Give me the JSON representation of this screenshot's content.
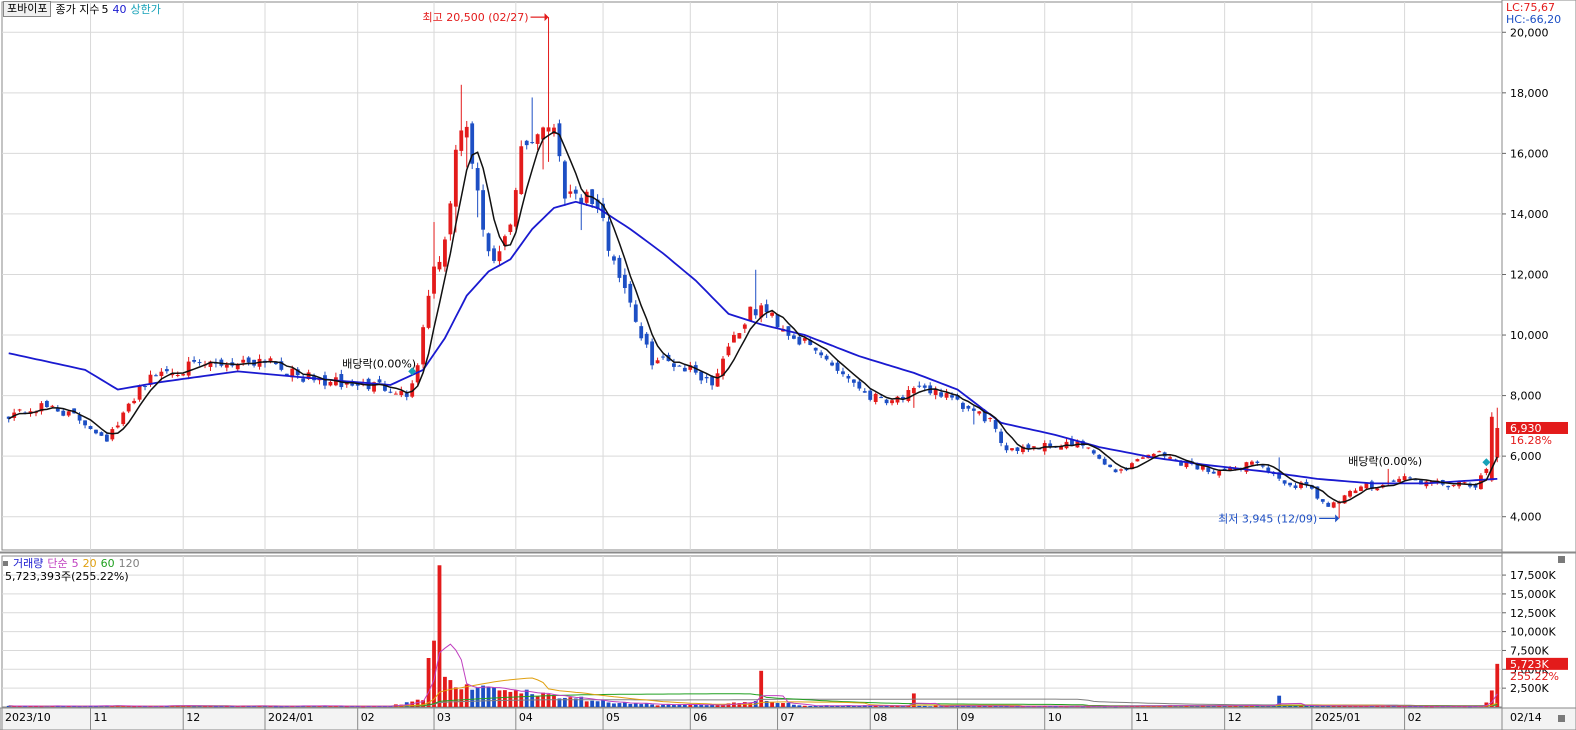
{
  "header": {
    "stock_name": "포바이포",
    "indicator_label": "종가 지수",
    "ma_short": "5",
    "ma_long": "40",
    "upper_limit_label": "상한가",
    "lc": "LC:75,67",
    "hc": "HC:-66,20"
  },
  "volume_header": {
    "title": "거래량",
    "ma_label": "단순",
    "periods": [
      "5",
      "20",
      "60",
      "120"
    ],
    "current": "5,723,393주(255.22%)"
  },
  "annotations": {
    "high": "최고 20,500 (02/27)",
    "low": "최저 3,945 (12/09)",
    "dividend_1": "배당락(0.00%)",
    "dividend_2": "배당락(0.00%)"
  },
  "price_badge": {
    "value": "6,930",
    "change": "16.28%"
  },
  "volume_badge": {
    "value": "5,723K",
    "change": "255.22%"
  },
  "colors": {
    "up": "#e31b1b",
    "down": "#1d4fc4",
    "ma5": "#111111",
    "ma40": "#1a1ad0",
    "grid": "#d9d9d9",
    "vol_ma5": "#c040c0",
    "vol_ma20": "#e0a010",
    "vol_ma60": "#20a020",
    "vol_ma120": "#808080"
  },
  "chart_data": [
    {
      "type": "candlestick",
      "title": "",
      "ylim": [
        2900,
        21000
      ],
      "y_ticks": [
        4000,
        6000,
        8000,
        10000,
        12000,
        14000,
        16000,
        18000,
        20000
      ],
      "y_tick_labels": [
        "4,000",
        "6,000",
        "8,000",
        "10,000",
        "12,000",
        "14,000",
        "16,000",
        "18,000",
        "20,000"
      ],
      "x_tick_labels": [
        "2023/10",
        "11",
        "12",
        "2024/01",
        "02",
        "03",
        "04",
        "05",
        "06",
        "07",
        "08",
        "09",
        "10",
        "11",
        "12",
        "2025/01",
        "02",
        "02/14"
      ],
      "legend": "none",
      "grid": true,
      "series": [
        {
          "name": "5",
          "values": []
        },
        {
          "name": "40",
          "values": []
        }
      ],
      "anchors": [
        [
          0,
          7400
        ],
        [
          8,
          7650
        ],
        [
          14,
          7100
        ],
        [
          18,
          6600
        ],
        [
          20,
          7000
        ],
        [
          24,
          8300
        ],
        [
          28,
          8800
        ],
        [
          36,
          9000
        ],
        [
          42,
          9100
        ],
        [
          48,
          9250
        ],
        [
          52,
          8700
        ],
        [
          58,
          8450
        ],
        [
          64,
          8350
        ],
        [
          70,
          8300
        ],
        [
          73,
          8000
        ],
        [
          75,
          9000
        ],
        [
          77,
          11500
        ],
        [
          80,
          13000
        ],
        [
          82,
          16000
        ],
        [
          84,
          16900
        ],
        [
          86,
          14500
        ],
        [
          88,
          12500
        ],
        [
          90,
          12600
        ],
        [
          92,
          13500
        ],
        [
          94,
          16000
        ],
        [
          96,
          16500
        ],
        [
          98,
          17000
        ],
        [
          100,
          16800
        ],
        [
          102,
          14800
        ],
        [
          106,
          14600
        ],
        [
          108,
          14200
        ],
        [
          110,
          13000
        ],
        [
          112,
          12000
        ],
        [
          114,
          11200
        ],
        [
          116,
          9800
        ],
        [
          118,
          9200
        ],
        [
          122,
          9100
        ],
        [
          126,
          8800
        ],
        [
          129,
          8400
        ],
        [
          132,
          9700
        ],
        [
          136,
          10700
        ],
        [
          138,
          10900
        ],
        [
          140,
          10600
        ],
        [
          143,
          10100
        ],
        [
          146,
          9700
        ],
        [
          150,
          9200
        ],
        [
          154,
          8600
        ],
        [
          158,
          8000
        ],
        [
          162,
          7900
        ],
        [
          166,
          8100
        ],
        [
          170,
          8200
        ],
        [
          174,
          7700
        ],
        [
          178,
          7350
        ],
        [
          180,
          7200
        ],
        [
          182,
          6300
        ],
        [
          186,
          6300
        ],
        [
          190,
          6350
        ],
        [
          194,
          6400
        ],
        [
          198,
          6300
        ],
        [
          200,
          5800
        ],
        [
          204,
          5500
        ],
        [
          208,
          6000
        ],
        [
          210,
          6150
        ],
        [
          214,
          5850
        ],
        [
          220,
          5550
        ],
        [
          224,
          5500
        ],
        [
          228,
          5850
        ],
        [
          230,
          5700
        ],
        [
          234,
          5000
        ],
        [
          238,
          5100
        ],
        [
          240,
          4700
        ],
        [
          242,
          4300
        ],
        [
          244,
          4500
        ],
        [
          248,
          5000
        ],
        [
          252,
          5050
        ],
        [
          256,
          5300
        ],
        [
          260,
          5100
        ],
        [
          266,
          5050
        ],
        [
          269,
          5000
        ],
        [
          271,
          5500
        ],
        [
          272,
          7100
        ],
        [
          273,
          6930
        ]
      ],
      "ma40_anchors": [
        [
          0,
          9400
        ],
        [
          14,
          8850
        ],
        [
          20,
          8200
        ],
        [
          28,
          8450
        ],
        [
          36,
          8650
        ],
        [
          42,
          8800
        ],
        [
          48,
          8700
        ],
        [
          60,
          8500
        ],
        [
          70,
          8350
        ],
        [
          76,
          8850
        ],
        [
          80,
          9900
        ],
        [
          84,
          11300
        ],
        [
          88,
          12100
        ],
        [
          92,
          12500
        ],
        [
          96,
          13500
        ],
        [
          100,
          14200
        ],
        [
          104,
          14400
        ],
        [
          108,
          14200
        ],
        [
          114,
          13500
        ],
        [
          120,
          12700
        ],
        [
          126,
          11800
        ],
        [
          132,
          10700
        ],
        [
          138,
          10350
        ],
        [
          146,
          10000
        ],
        [
          156,
          9300
        ],
        [
          166,
          8750
        ],
        [
          174,
          8200
        ],
        [
          182,
          7100
        ],
        [
          192,
          6700
        ],
        [
          200,
          6300
        ],
        [
          210,
          5950
        ],
        [
          220,
          5700
        ],
        [
          230,
          5500
        ],
        [
          240,
          5250
        ],
        [
          250,
          5100
        ],
        [
          260,
          5100
        ],
        [
          273,
          5250
        ]
      ],
      "spikes": [
        [
          78,
          4
        ],
        [
          82,
          2
        ],
        [
          83,
          3
        ],
        [
          84,
          2
        ],
        [
          86,
          2
        ],
        [
          96,
          3
        ],
        [
          98,
          2
        ],
        [
          99,
          1
        ],
        [
          105,
          1
        ],
        [
          137,
          4
        ],
        [
          166,
          1
        ],
        [
          177,
          2
        ],
        [
          233,
          3
        ],
        [
          272,
          1
        ]
      ],
      "high_marker": {
        "index": 99,
        "price": 20500
      },
      "low_marker": {
        "index": 244,
        "price": 3945
      }
    },
    {
      "type": "bar",
      "title": "",
      "ylim": [
        0,
        19500
      ],
      "y_ticks": [
        2500,
        5000,
        7500,
        10000,
        12500,
        15000,
        17500
      ],
      "y_tick_labels": [
        "2,500K",
        "5,000K",
        "7,500K",
        "10,000K",
        "12,500K",
        "15,000K",
        "17,500K"
      ],
      "legend": "none",
      "volume_anchors": [
        [
          0,
          150
        ],
        [
          70,
          120
        ],
        [
          76,
          900
        ],
        [
          77,
          6500
        ],
        [
          78,
          8800
        ],
        [
          79,
          18800
        ],
        [
          80,
          4000
        ],
        [
          82,
          2600
        ],
        [
          84,
          3000
        ],
        [
          86,
          2600
        ],
        [
          88,
          2600
        ],
        [
          90,
          2200
        ],
        [
          92,
          2000
        ],
        [
          94,
          1800
        ],
        [
          96,
          1700
        ],
        [
          98,
          1900
        ],
        [
          99,
          1700
        ],
        [
          102,
          1200
        ],
        [
          110,
          600
        ],
        [
          120,
          300
        ],
        [
          130,
          220
        ],
        [
          133,
          600
        ],
        [
          137,
          800
        ],
        [
          138,
          4800
        ],
        [
          139,
          800
        ],
        [
          145,
          220
        ],
        [
          165,
          150
        ],
        [
          166,
          1800
        ],
        [
          167,
          150
        ],
        [
          200,
          100
        ],
        [
          210,
          150
        ],
        [
          216,
          200
        ],
        [
          232,
          200
        ],
        [
          233,
          1500
        ],
        [
          234,
          200
        ],
        [
          260,
          100
        ],
        [
          270,
          120
        ],
        [
          271,
          600
        ],
        [
          272,
          2200
        ],
        [
          273,
          5723
        ]
      ]
    }
  ]
}
